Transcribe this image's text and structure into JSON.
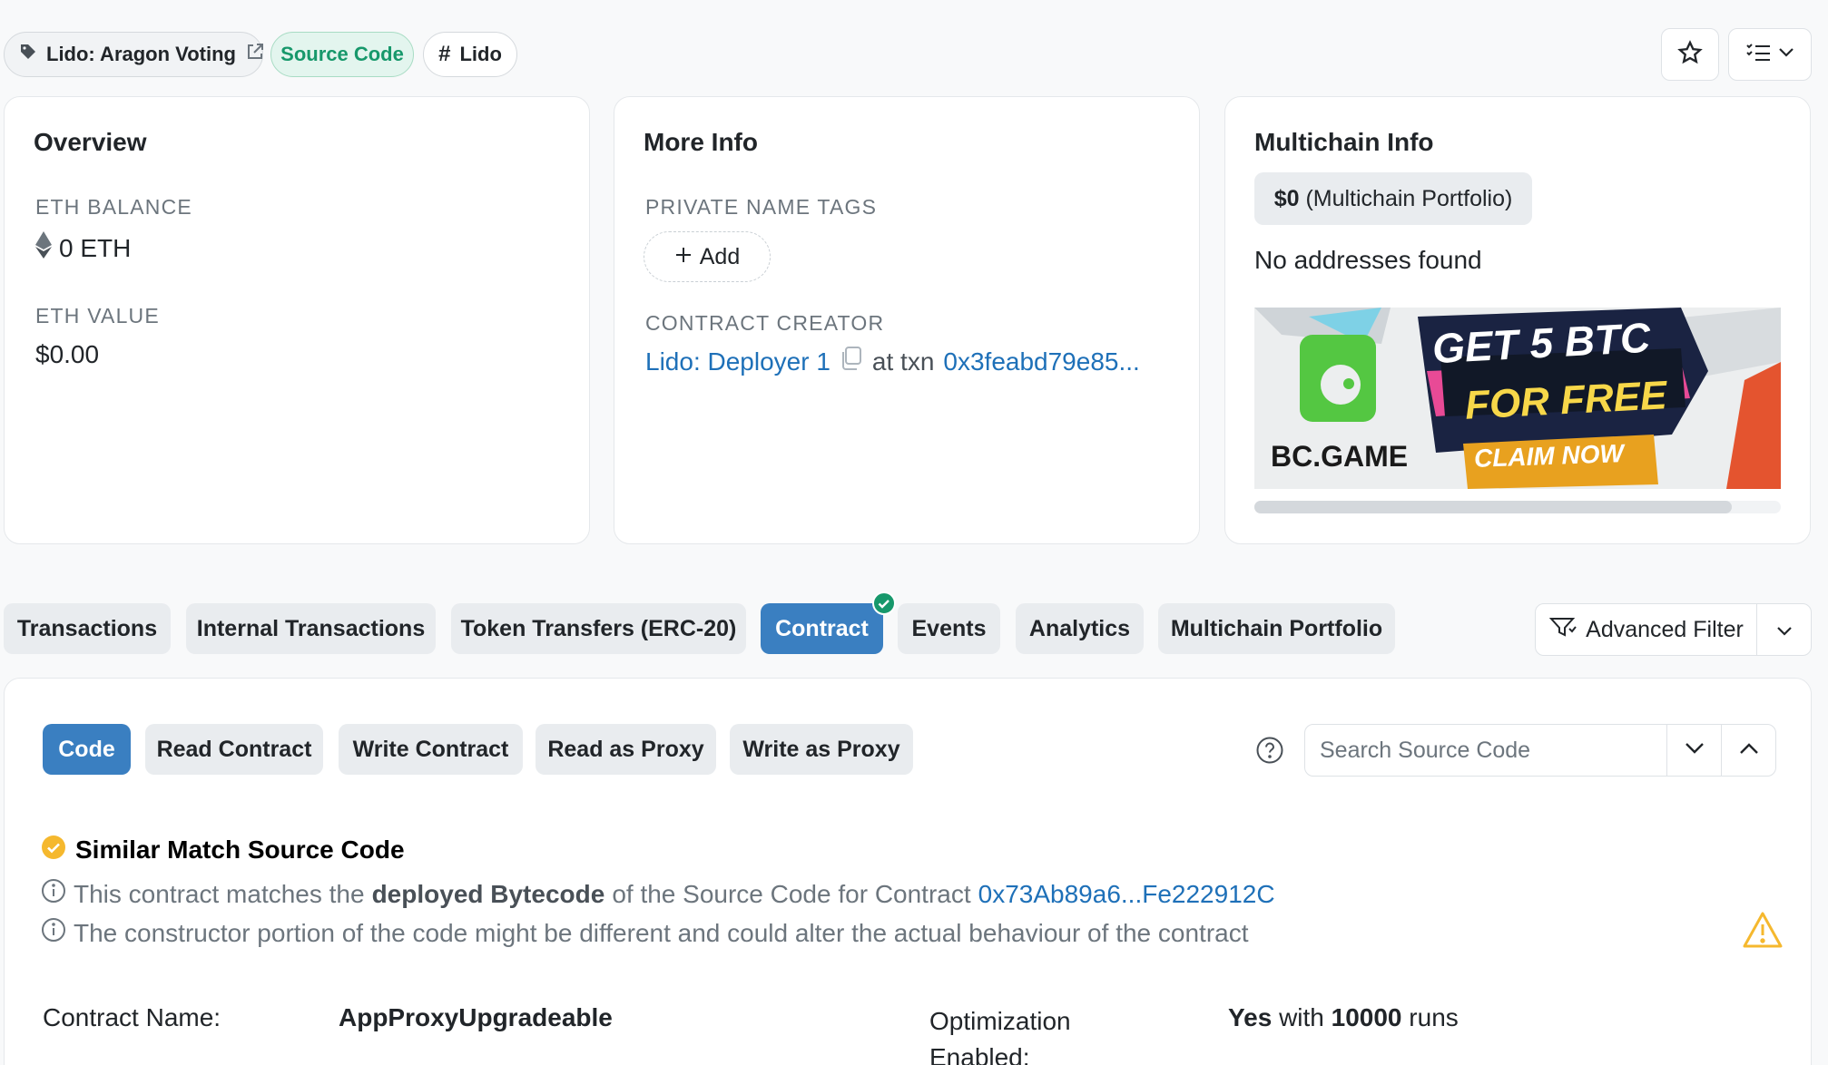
{
  "tags": {
    "name_tag": "Lido: Aragon Voting",
    "source_code": "Source Code",
    "hash_tag": "Lido"
  },
  "overview": {
    "title": "Overview",
    "eth_balance_label": "ETH BALANCE",
    "eth_balance_value": "0 ETH",
    "eth_value_label": "ETH VALUE",
    "eth_value_value": "$0.00"
  },
  "more_info": {
    "title": "More Info",
    "private_tags_label": "PRIVATE NAME TAGS",
    "add_label": "Add",
    "creator_label": "CONTRACT CREATOR",
    "creator_name": "Lido: Deployer 1",
    "at_txn": "at txn",
    "txn_hash": "0x3feabd79e85..."
  },
  "multichain": {
    "title": "Multichain Info",
    "portfolio_amount": "$0",
    "portfolio_text": "(Multichain Portfolio)",
    "no_addresses": "No addresses found"
  },
  "ad": {
    "brand": "BC.GAME",
    "line1": "GET 5 BTC",
    "line2": "FOR FREE",
    "cta": "CLAIM NOW"
  },
  "tabs": [
    {
      "label": "Transactions"
    },
    {
      "label": "Internal Transactions"
    },
    {
      "label": "Token Transfers (ERC-20)"
    },
    {
      "label": "Contract"
    },
    {
      "label": "Events"
    },
    {
      "label": "Analytics"
    },
    {
      "label": "Multichain Portfolio"
    }
  ],
  "advanced_filter": "Advanced Filter",
  "subtabs": [
    {
      "label": "Code"
    },
    {
      "label": "Read Contract"
    },
    {
      "label": "Write Contract"
    },
    {
      "label": "Read as Proxy"
    },
    {
      "label": "Write as Proxy"
    }
  ],
  "search": {
    "placeholder": "Search Source Code"
  },
  "match": {
    "title": "Similar Match Source Code",
    "line1_a": "This contract matches the",
    "line1_b": "deployed Bytecode",
    "line1_c": "of the Source Code for Contract",
    "line1_link": "0x73Ab89a6...Fe222912C",
    "line2": "The constructor portion of the code might be different and could alter the actual behaviour of the contract"
  },
  "details": {
    "contract_name_label": "Contract Name:",
    "contract_name_value": "AppProxyUpgradeable",
    "optimization_label_1": "Optimization",
    "optimization_label_2": "Enabled:",
    "opt_yes": "Yes",
    "opt_with": "with",
    "opt_runs_count": "10000",
    "opt_runs": "runs"
  },
  "colors": {
    "primary": "#3a7fc1",
    "link": "#1e70b8",
    "success": "#17986b",
    "warning": "#f5b82e"
  }
}
